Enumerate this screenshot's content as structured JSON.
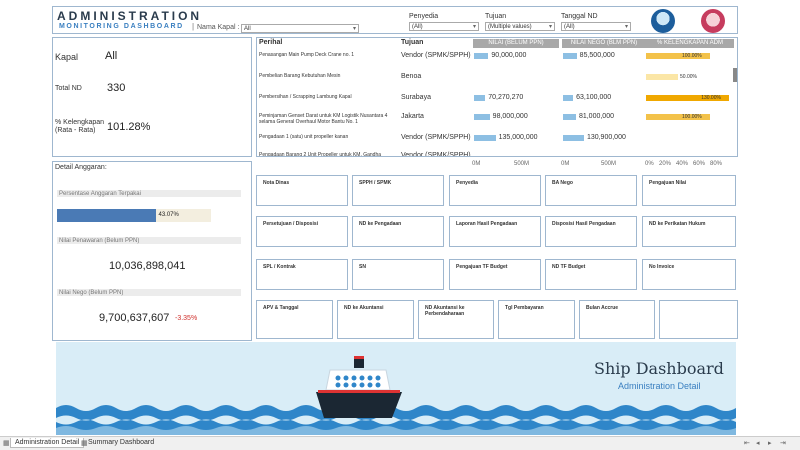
{
  "header": {
    "title": "ADMINISTRATION",
    "subtitle": "MONITORING DASHBOARD",
    "separator": "|",
    "kapal_label": "Nama Kapal :",
    "kapal_value": "All",
    "filters": [
      {
        "label": "Penyedia",
        "value": "(All)"
      },
      {
        "label": "Tujuan",
        "value": "(Multiple values)"
      },
      {
        "label": "Tanggal ND",
        "value": "(All)"
      }
    ]
  },
  "summary": {
    "kapal_label": "Kapal",
    "kapal_value": "All",
    "total_nd_label": "Total ND",
    "total_nd_value": "330",
    "kelengkapan_label_1": "% Kelengkapan",
    "kelengkapan_label_2": "(Rata - Rata)",
    "kelengkapan_value": "101.28%"
  },
  "detail": {
    "title": "Detail Anggaran:",
    "persentase_label": "Persentase Anggaran Terpakai",
    "persentase_value": "43.07%",
    "persentase_fraction": 0.4307,
    "penawaran_label": "Nilai Penawaran (Belum PPN)",
    "penawaran_value": "10,036,898,041",
    "nego_label": "Nilai Nego (Belum PPN)",
    "nego_value": "9,700,637,607",
    "nego_delta": "-3.35%"
  },
  "table": {
    "headers": {
      "perihal": "Perihal",
      "tujuan": "Tujuan",
      "nilai_belum": "NILAI (BELUM PPN)",
      "nilai_nego": "NILAI NEGO (BLM PPN)",
      "kelengkapan": "% KELENGKAPAN ADM"
    },
    "rows": [
      {
        "perihal": "Penasangan Main Pump Deck Crane no. 1",
        "tujuan": "Vendor (SPMK/SPPH)",
        "nilai": "90,000,000",
        "nilai_num": 90000000,
        "nego": "85,500,000",
        "nego_num": 85500000,
        "pct": "100.00%",
        "pct_num": 100,
        "pct_color": "#f3c24a"
      },
      {
        "perihal": "Pembelian Barang Kebutuhan Mesin",
        "tujuan": "Benoa",
        "nilai": "",
        "nilai_num": 0,
        "nego": "",
        "nego_num": 0,
        "pct": "50.00%",
        "pct_num": 50,
        "pct_color": "#fbe6a6"
      },
      {
        "perihal": "Pembersihan / Scrapping Lambung Kapal",
        "tujuan": "Surabaya",
        "nilai": "70,270,270",
        "nilai_num": 70270270,
        "nego": "63,100,000",
        "nego_num": 63100000,
        "pct": "130.00%",
        "pct_num": 130,
        "pct_color": "#f0a800"
      },
      {
        "perihal": "Peminjaman Genset Darat untuk KM Logistik Nusantara 4 selama General Overhaul Motor Bantu No. 1",
        "tujuan": "Jakarta",
        "nilai": "98,000,000",
        "nilai_num": 98000000,
        "nego": "81,000,000",
        "nego_num": 81000000,
        "pct": "100.00%",
        "pct_num": 100,
        "pct_color": "#f3c24a"
      },
      {
        "perihal": "Pengadaan 1 (satu) unit propeller kanan",
        "tujuan": "Vendor (SPMK/SPPH)",
        "nilai": "135,000,000",
        "nilai_num": 135000000,
        "nego": "130,900,000",
        "nego_num": 130900000,
        "pct": "",
        "pct_num": 0,
        "pct_color": "#f3c24a"
      },
      {
        "perihal": "Pengadaan Barang 2 Unit Propeller untuk KM. Gandha Nusantara 15",
        "tujuan": "Vendor (SPMK/SPPH)",
        "nilai": "",
        "nilai_num": 0,
        "nego": "",
        "nego_num": 0,
        "pct": "",
        "pct_num": 0,
        "pct_color": "#f3c24a"
      }
    ],
    "axis_nilai": [
      "0M",
      "500M"
    ],
    "axis_nego": [
      "0M",
      "500M"
    ],
    "axis_pct": [
      "0%",
      "20%",
      "40%",
      "60%",
      "80%"
    ]
  },
  "process": {
    "row1": [
      "Nota Dinas",
      "SPPH / SPMK",
      "Penyedia",
      "BA Nego",
      "Pengajuan Nilai"
    ],
    "row2": [
      "Persetujuan / Disposisi",
      "ND ke Pengadaan",
      "Laporan Hasil Pengadaan",
      "Disposisi Hasil Pengadaan",
      "ND ke Perikatan Hukum"
    ],
    "row3": [
      "SPL / Kontrak",
      "SN",
      "Pengajuan TF Budget",
      "ND TF Budget",
      "No Invoice"
    ],
    "row4": [
      "APV & Tanggal",
      "ND ke Akuntansi",
      "ND Akuntansi ke Perbendaharaan",
      "Tgl Pembayaran",
      "Bulan Accrue",
      ""
    ]
  },
  "banner": {
    "title": "Ship Dashboard",
    "subtitle": "Administration Detail"
  },
  "tabs": [
    "Administration Detail",
    "Summary Dashboard"
  ],
  "colors": {
    "accent": "#3a7fc0",
    "bar_blue": "#8dbfe3",
    "pct_bar": "#4a7ab5",
    "negative": "#d0312d",
    "banner_bg": "#d9edf7",
    "wave": "#2f86c9"
  }
}
